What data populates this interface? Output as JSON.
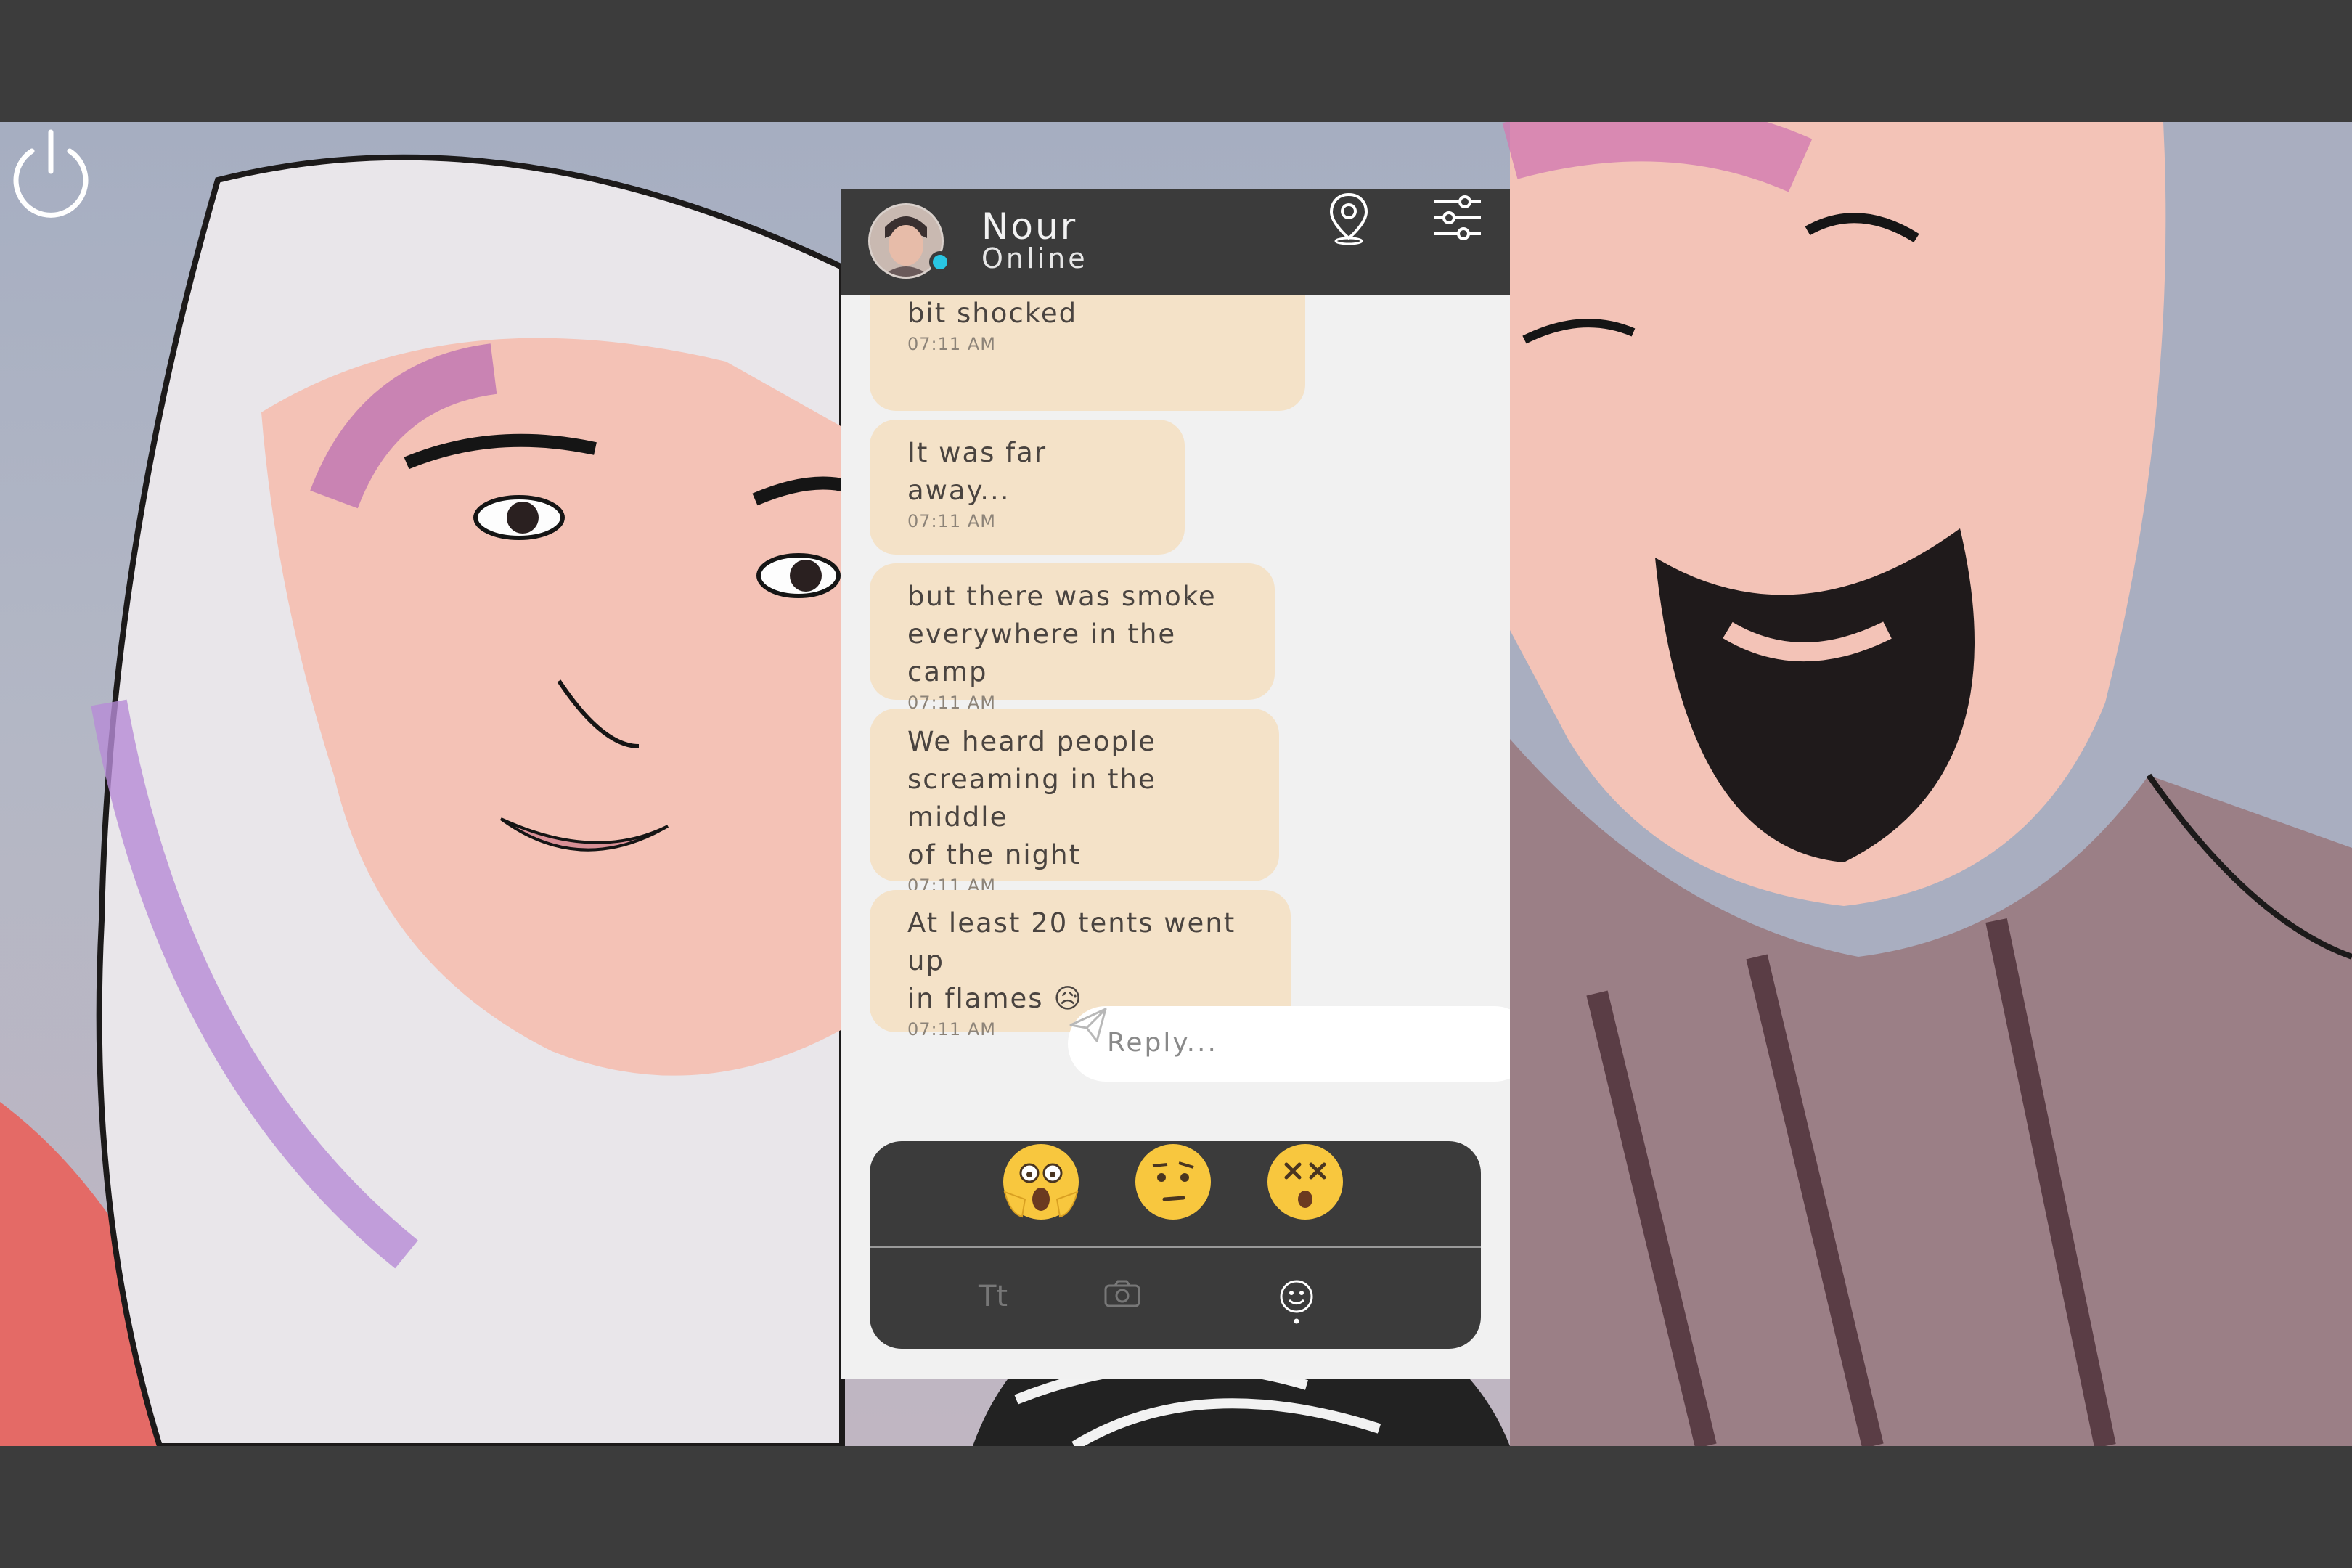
{
  "contact": {
    "name": "Nour",
    "status": "Online"
  },
  "messages": [
    {
      "text": "bit shocked",
      "time": "07:11 AM"
    },
    {
      "text": "It was far away...",
      "time": "07:11 AM"
    },
    {
      "text": "but there was smoke\neverywhere in the camp",
      "time": "07:11 AM"
    },
    {
      "text": "We heard people\nscreaming in the middle\nof the night",
      "time": "07:11 AM"
    },
    {
      "text": "At least 20 tents went up\nin flames 😥",
      "time": "07:11 AM"
    }
  ],
  "reply": {
    "placeholder": "Reply..."
  },
  "keyboard": {
    "emoji_options": [
      "😱",
      "🤨",
      "😵"
    ],
    "tabs": {
      "text_label": "Tt"
    }
  },
  "colors": {
    "bubble": "#f4e2c8",
    "header": "#3b3b3b",
    "status_online": "#29c6e3",
    "letterbox": "#3c3c3c"
  },
  "icons": {
    "power": "power-icon",
    "location": "location-pin-icon",
    "settings": "sliders-icon",
    "send": "send-icon",
    "camera": "camera-icon",
    "emoji_tab": "smiley-icon"
  }
}
